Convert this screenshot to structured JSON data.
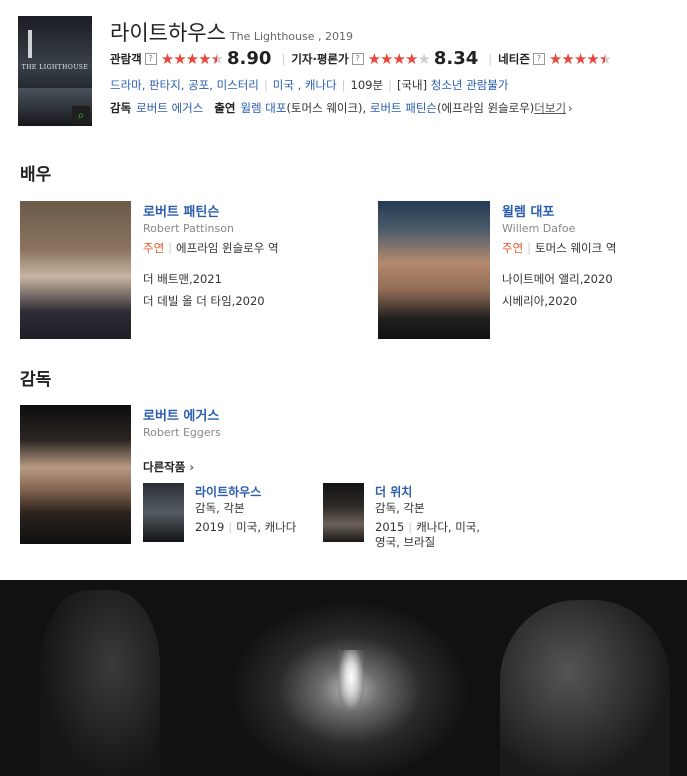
{
  "movie": {
    "title_ko": "라이트하우스",
    "title_en_year": "The Lighthouse , 2019",
    "poster_text": "THE LIGHTHOUSE",
    "ratings": [
      {
        "label": "관람객",
        "score": "8.90",
        "stars": 4.5
      },
      {
        "label": "기자·평론가",
        "score": "8.34",
        "stars": 4.0
      },
      {
        "label": "네티즌",
        "score": "",
        "stars": 4.5
      }
    ],
    "help_glyph": "?",
    "genres": "드라마, 판타지, 공포, 미스터리",
    "countries": "미국 , 캐나다",
    "runtime": "109분",
    "rating_prefix": "[국내]",
    "age_rating": "청소년 관람불가",
    "director_label": "감독",
    "director": "로버트 에거스",
    "cast_label": "출연",
    "cast_1": "윌렘 대포",
    "cast_1_role": "(토머스 웨이크),",
    "cast_2": "로버트 패틴슨",
    "cast_2_role": "(에프라임 윈슬로우)",
    "more": "더보기",
    "more_arrow": "›"
  },
  "actors_section": "배우",
  "actors": [
    {
      "name": "로버트 패틴슨",
      "name_en": "Robert Pattinson",
      "tag": "주연",
      "role": "에프라임 윈슬로우 역",
      "works": [
        "더 배트맨,2021",
        "더 데빌 올 더 타임,2020"
      ]
    },
    {
      "name": "윌렘 대포",
      "name_en": "Willem Dafoe",
      "tag": "주연",
      "role": "토머스 웨이크 역",
      "works": [
        "나이트메어 앨리,2020",
        "시베리아,2020"
      ]
    }
  ],
  "director_section": "감독",
  "director": {
    "name": "로버트 에거스",
    "name_en": "Robert Eggers",
    "other_works_label": "다른작품",
    "other_works_arrow": "›",
    "works": [
      {
        "title": "라이트하우스",
        "role": "감독, 각본",
        "year": "2019",
        "countries": "미국, 캐나다"
      },
      {
        "title": "더 위치",
        "role": "감독, 각본",
        "year": "2015",
        "countries": "캐나다, 미국, 영국, 브라질"
      }
    ]
  },
  "colors": {
    "link": "#2a5db0",
    "star": "#e8473d",
    "tag": "#e0572a"
  }
}
